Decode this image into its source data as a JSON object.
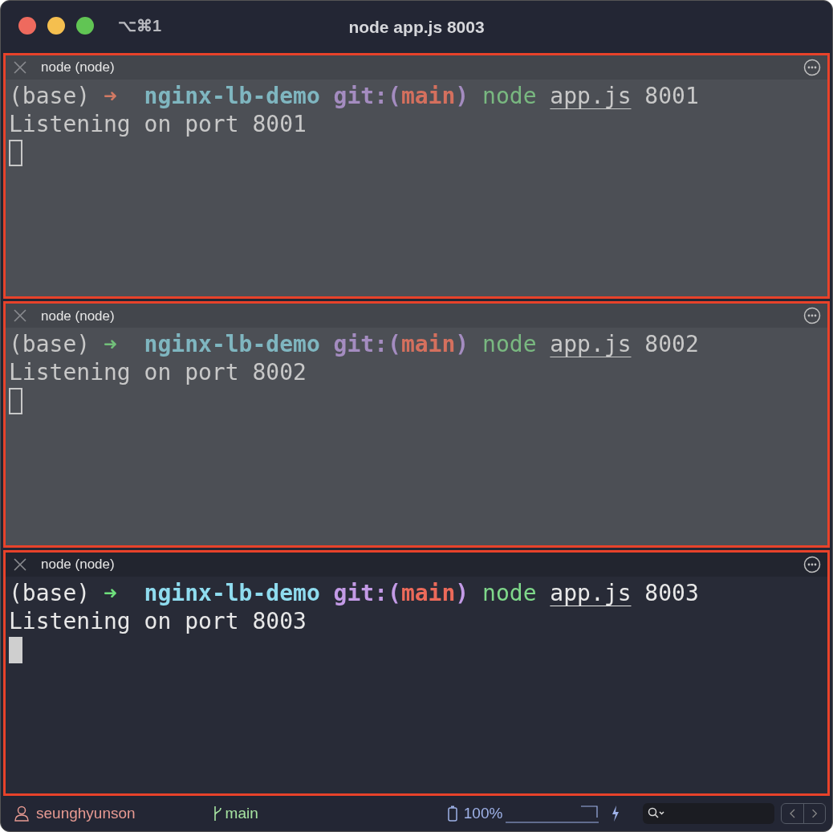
{
  "window": {
    "shortcut": "⌥⌘1",
    "title": "node app.js 8003"
  },
  "panes": [
    {
      "title": "node (node)",
      "active": false,
      "env": "(base)",
      "arrow": {
        "text": "➜",
        "color": "#d27a64"
      },
      "dir": "nginx-lb-demo",
      "git_open": "git:(",
      "branch": "main",
      "git_close": ")",
      "command": "node",
      "arg": "app.js",
      "port": "8001",
      "output": "Listening on port 8001"
    },
    {
      "title": "node (node)",
      "active": false,
      "env": "(base)",
      "arrow": {
        "text": "➜",
        "color": "#72c07a"
      },
      "dir": "nginx-lb-demo",
      "git_open": "git:(",
      "branch": "main",
      "git_close": ")",
      "command": "node",
      "arg": "app.js",
      "port": "8002",
      "output": "Listening on port 8002"
    },
    {
      "title": "node (node)",
      "active": true,
      "env": "(base)",
      "arrow": {
        "text": "➜",
        "color": "#6ee07c"
      },
      "dir": "nginx-lb-demo",
      "git_open": "git:(",
      "branch": "main",
      "git_close": ")",
      "command": "node",
      "arg": "app.js",
      "port": "8003",
      "output": "Listening on port 8003"
    }
  ],
  "status_bar": {
    "user": "seunghyunson",
    "branch": "main",
    "battery": "100%"
  }
}
